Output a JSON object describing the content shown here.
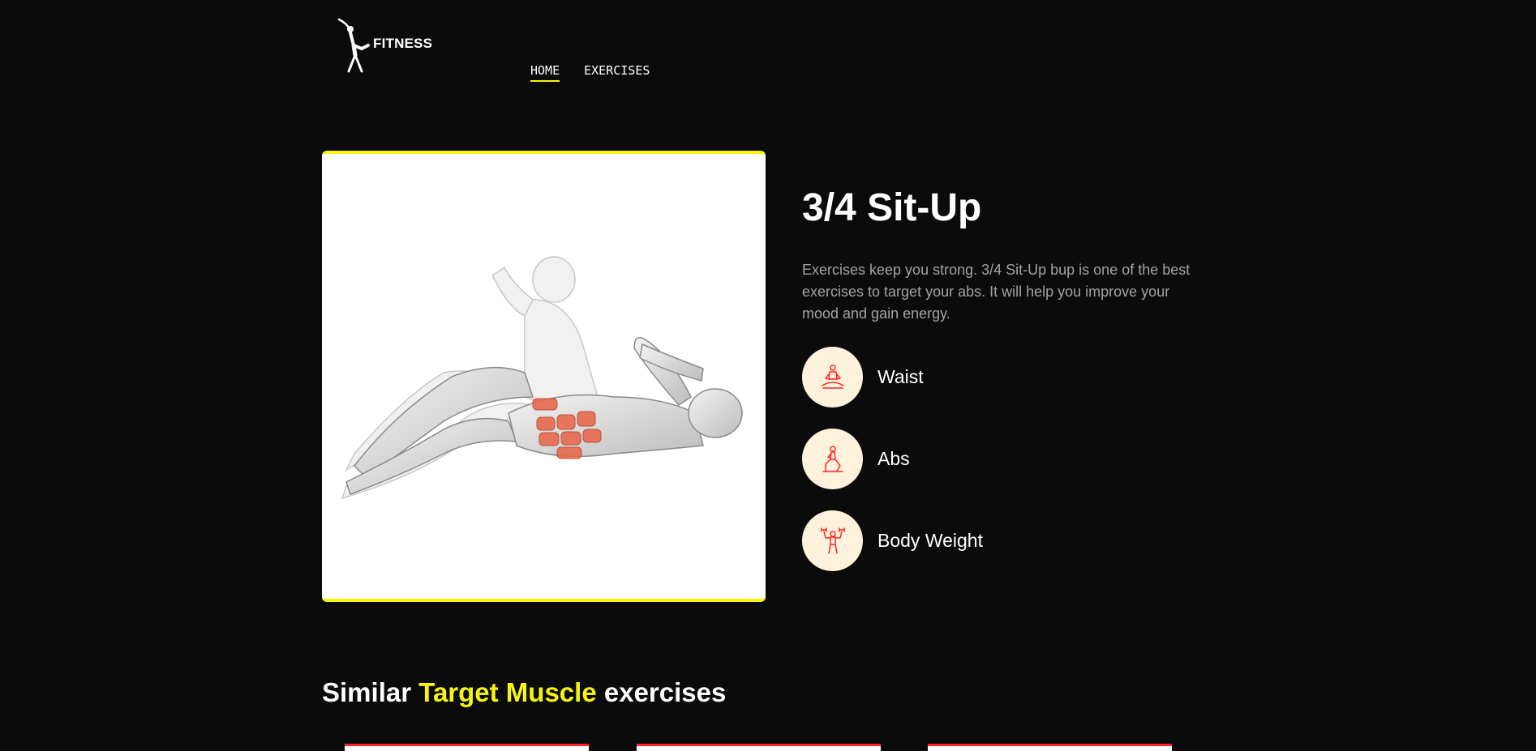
{
  "brand": {
    "logo_text": "FITNESS",
    "logo_icon": "stretching-figure-icon",
    "accent": "#f5f50f"
  },
  "nav": {
    "home": "HOME",
    "exercises": "EXERCISES"
  },
  "exercise": {
    "image_icon": "sit-up-anatomy-illustration",
    "title": "3/4 Sit-Up",
    "description": "Exercises keep you strong. 3/4 Sit-Up bup is one of the best exercises to target your abs. It will help you improve your mood and gain energy.",
    "tags": [
      {
        "label": "Waist",
        "icon": "meditation-pose-icon"
      },
      {
        "label": "Abs",
        "icon": "lunge-pose-icon"
      },
      {
        "label": "Body Weight",
        "icon": "dumbbell-lift-icon"
      }
    ]
  },
  "similar": {
    "prefix": "Similar",
    "highlight": "Target Muscle",
    "suffix": "exercises"
  },
  "colors": {
    "background": "#0b0b0b",
    "tag_bg": "#fff2dc",
    "tag_icon_stroke": "#ff2625",
    "card_border": "#ff2625"
  }
}
